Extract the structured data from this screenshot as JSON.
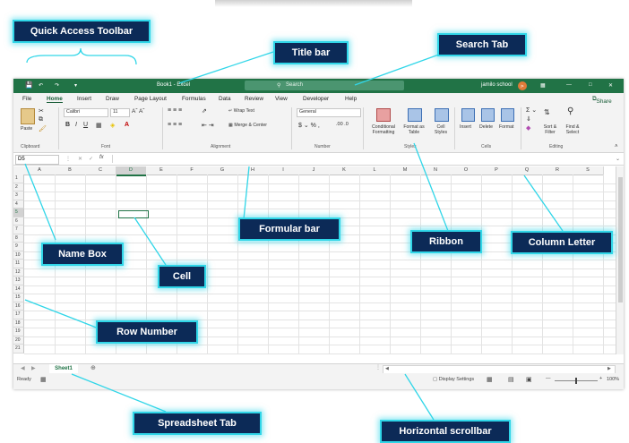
{
  "window": {
    "title": "Book1 - Excel",
    "search_placeholder": "Search",
    "user": "jamilo school",
    "avatar_initial": "js"
  },
  "menu_tabs": [
    "File",
    "Home",
    "Insert",
    "Draw",
    "Page Layout",
    "Formulas",
    "Data",
    "Review",
    "View",
    "Developer",
    "Help"
  ],
  "share_label": "Share",
  "ribbon": {
    "clipboard": {
      "paste": "Paste",
      "label": "Clipboard"
    },
    "font": {
      "name": "Calibri",
      "size": "11",
      "label": "Font"
    },
    "alignment": {
      "wrap": "Wrap Text",
      "merge": "Merge & Center",
      "label": "Alignment"
    },
    "number": {
      "format": "General",
      "label": "Number"
    },
    "styles": {
      "conditional": "Conditional Formatting",
      "format_table": "Format as Table",
      "cell_styles": "Cell Styles",
      "label": "Styles"
    },
    "cells": {
      "insert": "Insert",
      "delete": "Delete",
      "format": "Format",
      "label": "Cells"
    },
    "editing": {
      "sort": "Sort & Filter",
      "find": "Find & Select",
      "label": "Editing"
    }
  },
  "formula_bar": {
    "name_box": "D5",
    "fx": "fx"
  },
  "columns": [
    "A",
    "B",
    "C",
    "D",
    "E",
    "F",
    "G",
    "H",
    "I",
    "J",
    "K",
    "L",
    "M",
    "N",
    "O",
    "P",
    "Q",
    "R",
    "S"
  ],
  "rows": [
    "1",
    "2",
    "3",
    "4",
    "5",
    "6",
    "7",
    "8",
    "9",
    "10",
    "11",
    "12",
    "13",
    "14",
    "15",
    "16",
    "17",
    "18",
    "19",
    "20",
    "21"
  ],
  "sheet_tab": "Sheet1",
  "status": {
    "ready": "Ready",
    "display_settings": "Display Settings",
    "zoom": "100%"
  },
  "callouts": {
    "quick_access": "Quick Access Toolbar",
    "title_bar": "Title bar",
    "search_tab": "Search Tab",
    "formula_bar": "Formular bar",
    "ribbon": "Ribbon",
    "column_letter": "Column Letter",
    "name_box": "Name Box",
    "cell": "Cell",
    "row_number": "Row Number",
    "spreadsheet_tab": "Spreadsheet Tab",
    "horizontal_scrollbar": "Horizontal scrollbar"
  },
  "colors": {
    "excel_green": "#217346",
    "callout_bg": "#0c2a57",
    "callout_glow": "#30d6e8"
  }
}
